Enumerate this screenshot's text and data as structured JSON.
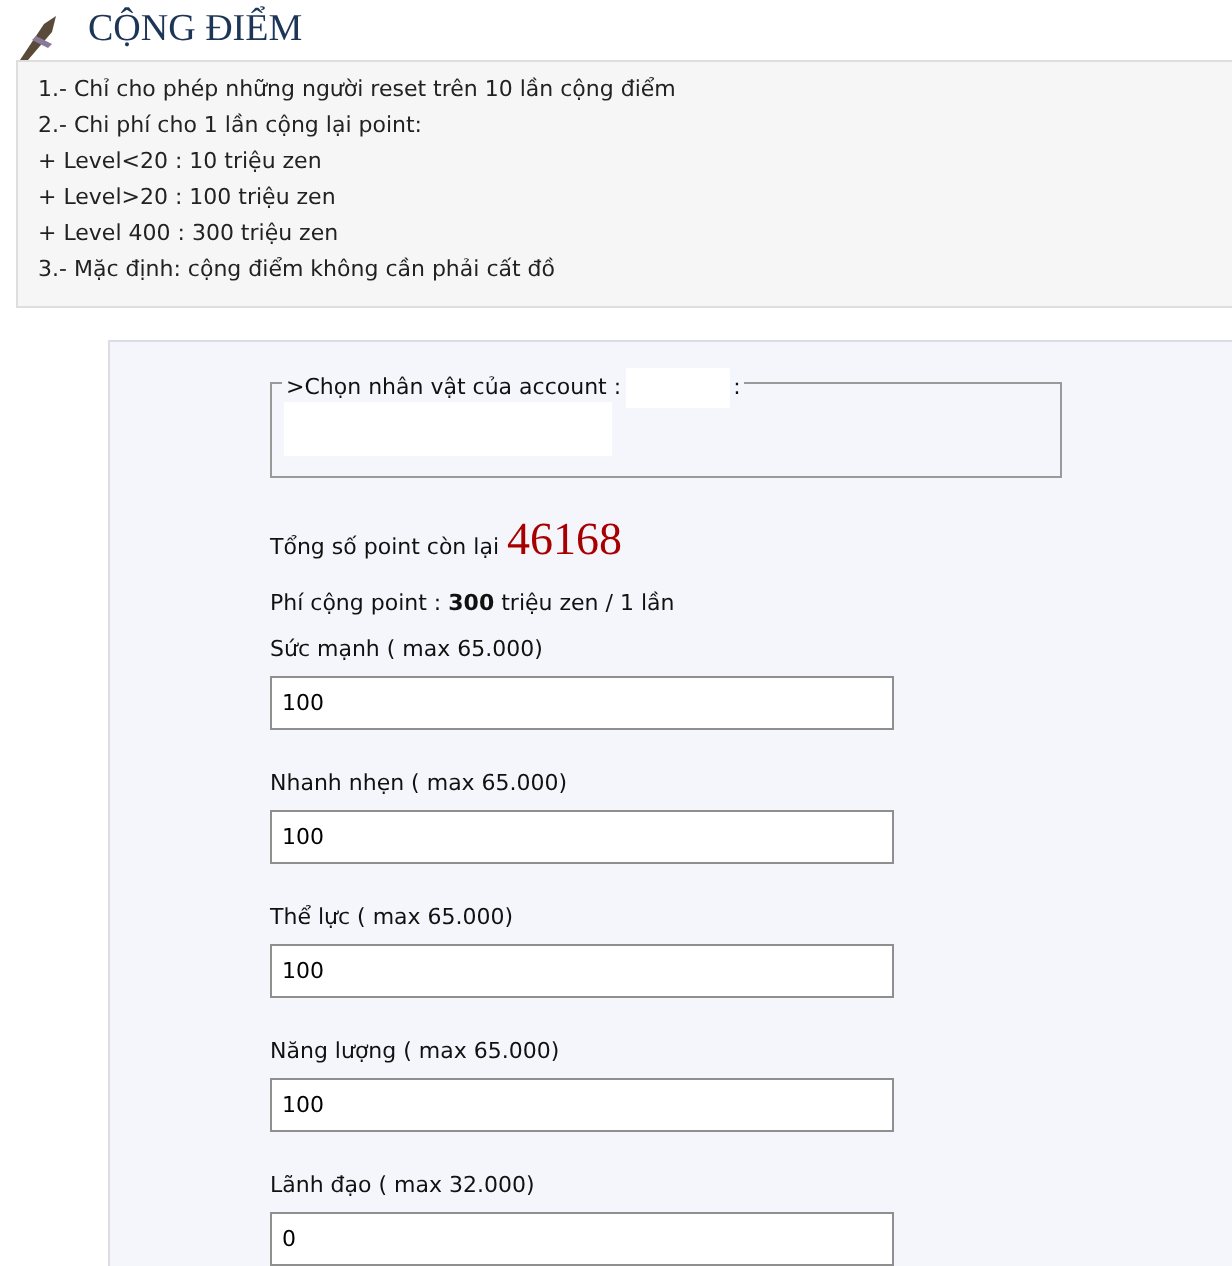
{
  "header": {
    "title": "CỘNG ĐIỂM"
  },
  "notes": [
    "1.- Chỉ cho phép những người reset trên 10 lần cộng điểm",
    "2.- Chi phí cho 1 lần cộng lại point:",
    "+ Level<20 : 10 triệu zen",
    "+ Level>20 : 100 triệu zen",
    "+ Level 400 : 300 triệu zen",
    "3.- Mặc định: cộng điểm không cần phải cất đồ"
  ],
  "character_select": {
    "legend": ">Chọn nhân vật của account :",
    "legend_end": ":"
  },
  "points": {
    "label": "Tổng số point còn lại",
    "value": "46168"
  },
  "fee": "Phí cộng point : **300** triệu zen / 1 lần",
  "stats": [
    {
      "label": "Sức mạnh ( max 65.000)",
      "value": "100"
    },
    {
      "label": "Nhanh nhẹn ( max 65.000)",
      "value": "100"
    },
    {
      "label": "Thể lực ( max 65.000)",
      "value": "100"
    },
    {
      "label": "Năng lượng ( max 65.000)",
      "value": "100"
    },
    {
      "label": "Lãnh đạo ( max 32.000)",
      "value": "0"
    }
  ]
}
